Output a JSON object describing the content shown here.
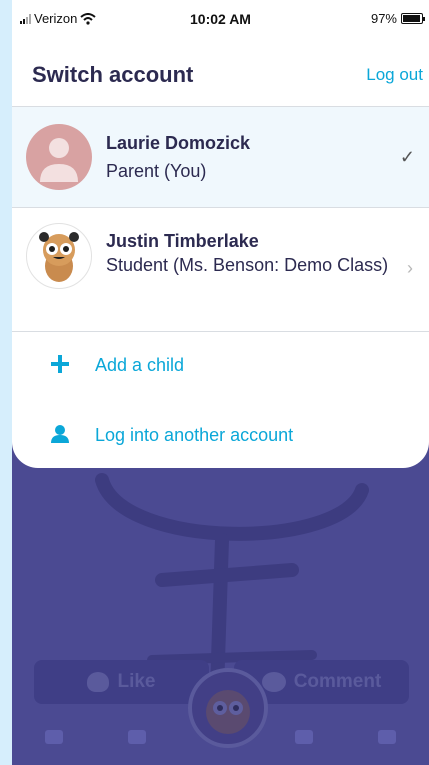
{
  "status_bar": {
    "carrier": "Verizon",
    "time": "10:02 AM",
    "battery": "97%",
    "battery_level": 0.97
  },
  "sheet": {
    "title": "Switch account",
    "logout_label": "Log out",
    "accounts": [
      {
        "name": "Laurie Domozick",
        "role": "Parent (You)",
        "selected": true,
        "indicator": "✓"
      },
      {
        "name": "Justin Timberlake",
        "role": "Student (Ms. Benson: Demo Class)",
        "selected": false,
        "indicator": "›"
      }
    ],
    "actions": [
      {
        "label": "Add a child",
        "icon": "plus-icon"
      },
      {
        "label": "Log into another account",
        "icon": "person-icon"
      }
    ]
  },
  "background": {
    "like_label": "Like",
    "comment_label": "Comment"
  },
  "colors": {
    "accent": "#0ba7d8",
    "title_text": "#2c2a50",
    "overlay": "#4a4990"
  }
}
